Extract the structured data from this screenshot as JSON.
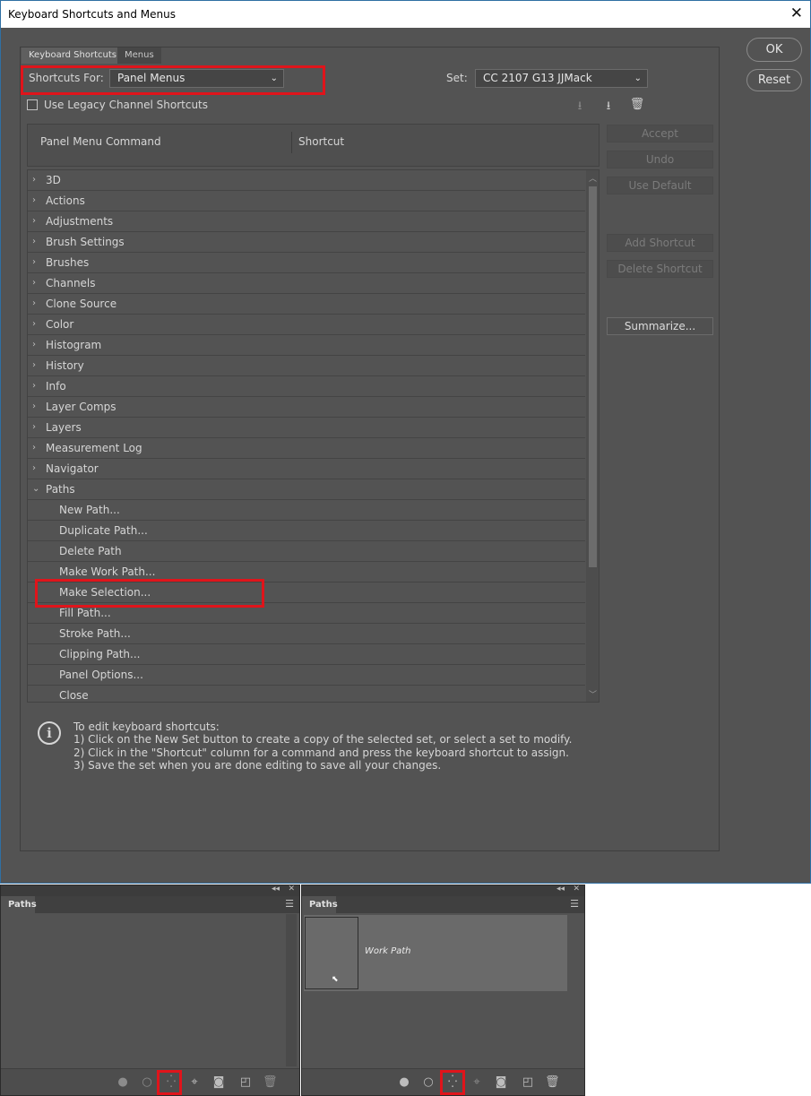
{
  "dialog": {
    "title": "Keyboard Shortcuts and Menus",
    "tabs": [
      "Keyboard Shortcuts",
      "Menus"
    ],
    "shortcuts_for_label": "Shortcuts For:",
    "shortcuts_for_value": "Panel Menus",
    "set_label": "Set:",
    "set_value": "CC 2107 G13 JJMack",
    "legacy_checkbox_label": "Use Legacy Channel Shortcuts",
    "column_command": "Panel Menu Command",
    "column_shortcut": "Shortcut",
    "buttons": {
      "ok": "OK",
      "reset": "Reset",
      "accept": "Accept",
      "undo": "Undo",
      "use_default": "Use Default",
      "add_shortcut": "Add Shortcut",
      "delete_shortcut": "Delete Shortcut",
      "summarize": "Summarize..."
    },
    "rows": [
      {
        "label": "3D",
        "arrow": "›"
      },
      {
        "label": "Actions",
        "arrow": "›"
      },
      {
        "label": "Adjustments",
        "arrow": "›"
      },
      {
        "label": "Brush Settings",
        "arrow": "›"
      },
      {
        "label": "Brushes",
        "arrow": "›"
      },
      {
        "label": "Channels",
        "arrow": "›"
      },
      {
        "label": "Clone Source",
        "arrow": "›"
      },
      {
        "label": "Color",
        "arrow": "›"
      },
      {
        "label": "Histogram",
        "arrow": "›"
      },
      {
        "label": "History",
        "arrow": "›"
      },
      {
        "label": "Info",
        "arrow": "›"
      },
      {
        "label": "Layer Comps",
        "arrow": "›"
      },
      {
        "label": "Layers",
        "arrow": "›"
      },
      {
        "label": "Measurement Log",
        "arrow": "›"
      },
      {
        "label": "Navigator",
        "arrow": "›"
      },
      {
        "label": "Paths",
        "arrow": "⌄"
      },
      {
        "label": "New Path...",
        "arrow": ""
      },
      {
        "label": "Duplicate Path...",
        "arrow": ""
      },
      {
        "label": "Delete Path",
        "arrow": ""
      },
      {
        "label": "Make Work Path...",
        "arrow": ""
      },
      {
        "label": "Make Selection...",
        "arrow": ""
      },
      {
        "label": "Fill Path...",
        "arrow": ""
      },
      {
        "label": "Stroke Path...",
        "arrow": ""
      },
      {
        "label": "Clipping Path...",
        "arrow": ""
      },
      {
        "label": "Panel Options...",
        "arrow": ""
      },
      {
        "label": "Close",
        "arrow": ""
      }
    ],
    "info_lines": [
      "To edit keyboard shortcuts:",
      "1) Click on the New Set button to create a copy of the selected set, or select a set to modify.",
      "2) Click in the \"Shortcut\" column for a command and press the keyboard shortcut to assign.",
      "3) Save the set when you are done editing to save all your changes."
    ]
  },
  "panels": {
    "left_tab": "Paths",
    "right_tab": "Paths",
    "work_path": "Work Path"
  }
}
